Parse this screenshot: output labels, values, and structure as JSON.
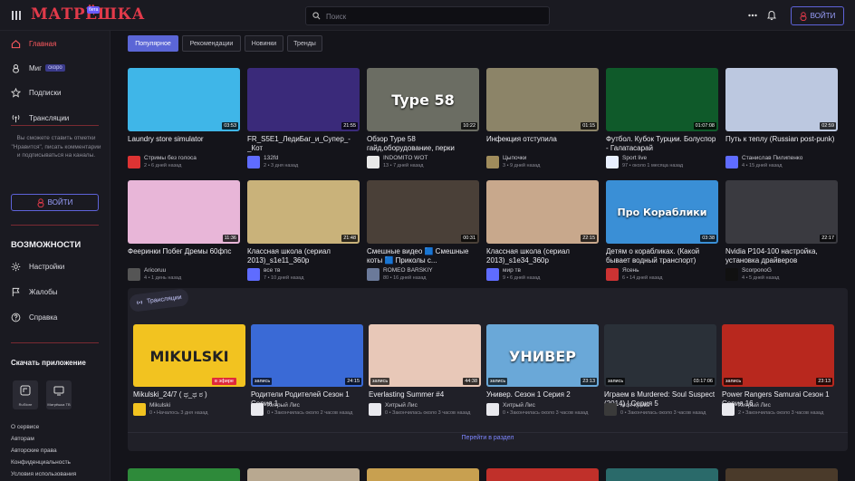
{
  "header": {
    "logo": "МАТРЁШКА",
    "logo_badge": "бета",
    "search_placeholder": "Поиск",
    "login_label": "ВОЙТИ"
  },
  "sidebar": {
    "nav": [
      {
        "label": "Главная",
        "icon": "home-icon",
        "active": true
      },
      {
        "label": "Миг",
        "icon": "flame-icon",
        "badge": "скоро"
      },
      {
        "label": "Подписки",
        "icon": "star-icon"
      },
      {
        "label": "Трансляции",
        "icon": "broadcast-icon"
      }
    ],
    "note": "Вы сможете ставить отметки \"Нравится\", писать комментарии и подписываться на каналы.",
    "login_label": "ВОЙТИ",
    "features_title": "ВОЗМОЖНОСТИ",
    "features": [
      {
        "label": "Настройки",
        "icon": "gear-icon"
      },
      {
        "label": "Жалобы",
        "icon": "flag-icon"
      },
      {
        "label": "Справка",
        "icon": "help-icon"
      }
    ],
    "download_title": "Скачать приложение",
    "apps": [
      {
        "label": "RuStore"
      },
      {
        "label": "Матрёшка ТВ"
      }
    ],
    "footer_links": [
      "О сервисе",
      "Авторам",
      "Авторские права",
      "Конфиденциальность",
      "Условия использования"
    ]
  },
  "tabs": [
    "Популярное",
    "Рекомендации",
    "Новинки",
    "Тренды"
  ],
  "videos_row1": [
    {
      "title": "Laundry store simulator",
      "channel": "Стримы без голоса",
      "meta": "2 • 6 дней назад",
      "duration": "03:53",
      "bg": "#3fb6e8",
      "avatar": "#d33"
    },
    {
      "title": "FR_S5E1_ЛедиБаг_и_Супер_-_Кот",
      "channel": "132fd",
      "meta": "2 • 3 дня назад",
      "duration": "21:55",
      "bg": "#3a2a7a",
      "avatar": "#5f6cff"
    },
    {
      "title": "Обзор Type 58 гайд,оборудование, перки",
      "channel": "INDOMITO WOT",
      "meta": "13 • 7 дней назад",
      "duration": "10:22",
      "bg": "#6b6d63",
      "avatar": "#e8e8e8",
      "thumb_text": "Type 58"
    },
    {
      "title": "Инфекция отступила",
      "channel": "Цыпочки",
      "meta": "3 • 9 дней назад",
      "duration": "01:15",
      "bg": "#8c8468",
      "avatar": "#a08c5c"
    },
    {
      "title": "Футбол. Кубок Турции. Болуспор - Галатасарай",
      "channel": "Sport live",
      "meta": "97 • около 1 месяца назад",
      "duration": "01:07:08",
      "bg": "#0f5a2a",
      "avatar": "#e9f0ff"
    },
    {
      "title": "Путь к теплу (Russian post-punk)",
      "channel": "Станислав Пилипенко",
      "meta": "4 • 15 дней назад",
      "duration": "02:59",
      "bg": "#bcc8e0",
      "avatar": "#5f6cff"
    }
  ],
  "videos_row2": [
    {
      "title": "Фееринки Побег Дремы 60фпс",
      "channel": "Aricoruu",
      "meta": "4 • 1 день назад",
      "duration": "11:36",
      "bg": "#e8b6d8",
      "avatar": "#555"
    },
    {
      "title": "Классная школа (сериал 2013)_s1e11_360p",
      "channel": "все тв",
      "meta": "7 • 10 дней назад",
      "duration": "21:48",
      "bg": "#c9b27a",
      "avatar": "#5f6cff"
    },
    {
      "title": "Смешные видео 🟦 Смешные коты 🟦 Приколы с...",
      "channel": "ROMEO BARSKIY",
      "meta": "80 • 16 дней назад",
      "duration": "00:31",
      "bg": "#4a4038",
      "avatar": "#6b7a9a"
    },
    {
      "title": "Классная школа (сериал 2013)_s1e34_360p",
      "channel": "мир тв",
      "meta": "9 • 6 дней назад",
      "duration": "22:15",
      "bg": "#c8a88c",
      "avatar": "#5f6cff"
    },
    {
      "title": "Детям о корабликах. (Какой бывает водный транспорт)",
      "channel": "Ясень",
      "meta": "6 • 14 дней назад",
      "duration": "03:38",
      "bg": "#3a8fd6",
      "avatar": "#cc3333",
      "thumb_text": "Про Кораблики"
    },
    {
      "title": "Nvidia P104-100 настройка, установка драйверов",
      "channel": "ScorponoG",
      "meta": "4 • 5 дней назад",
      "duration": "22:17",
      "bg": "#3a3a40",
      "avatar": "#111"
    }
  ],
  "live": {
    "pill_label": "Трансляции",
    "go_label": "Перейти в раздел",
    "items": [
      {
        "title": "Mikulski_24/7 ( ಥ_ಥ ಠ )",
        "channel": "Mikulski",
        "meta": "0 • Началось 3 дня назад",
        "badge": "в эфире",
        "badge_type": "live",
        "bg": "#f2c320",
        "avatar": "#f2c320",
        "thumb_text": "MIKULSKI"
      },
      {
        "title": "Родители Родителей Сезон 1 Серия 1",
        "channel": "Хитрый Лис",
        "meta": "0 • Закончилась около 2 часов назад",
        "badge": "запись",
        "duration": "24:15",
        "bg": "#3a6ad6",
        "avatar": "#e9e9ee"
      },
      {
        "title": "Everlasting Summer #4",
        "channel": "Хитрый Лис",
        "meta": "0 • Закончилась около 3 часов назад",
        "badge": "запись",
        "duration": "44:38",
        "bg": "#e8c8b8",
        "avatar": "#e9e9ee"
      },
      {
        "title": "Универ. Сезон 1 Серия 2",
        "channel": "Хитрый Лис",
        "meta": "0 • Закончилась около 3 часов назад",
        "badge": "запись",
        "duration": "23:13",
        "bg": "#6aa8d8",
        "avatar": "#e9e9ee",
        "thumb_text": "УНИВЕР"
      },
      {
        "title": "Играем в Murdered: Soul Suspect (2014) | Серия 5",
        "channel": "Моя Кровь",
        "meta": "0 • Закончилась около 3 часов назад",
        "badge": "запись",
        "duration": "03:17:06",
        "bg": "#2a3038",
        "avatar": "#3a3a3a"
      },
      {
        "title": "Power Rangers Samurai Сезон 1 Серия 16",
        "channel": "Хитрый Лис",
        "meta": "2 • Закончилась около 3 часов назад",
        "badge": "запись",
        "duration": "23:13",
        "bg": "#b8281e",
        "avatar": "#e9e9ee"
      }
    ]
  }
}
